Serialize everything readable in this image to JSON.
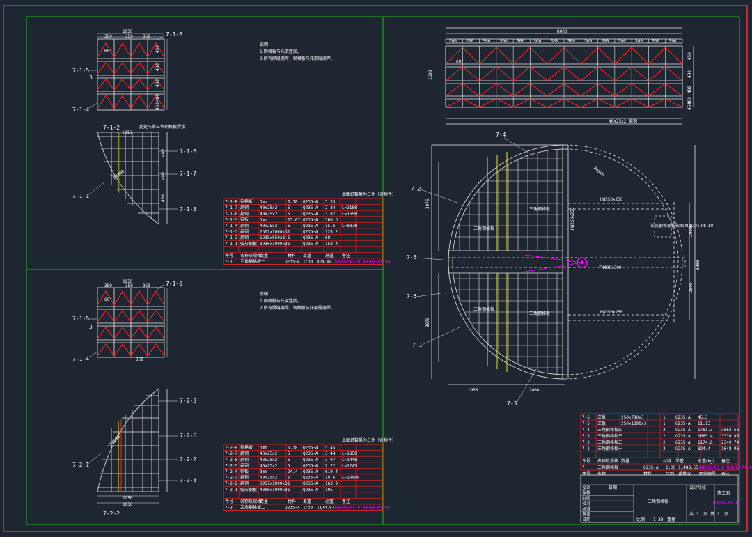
{
  "colors": {
    "background": "#1e2632",
    "border": "#ff2a2a",
    "frame": "#1fb81f",
    "line": "#e8e8e8",
    "red": "#ff2020",
    "yellow": "#e6e619",
    "magenta": "#ff00ff"
  },
  "view1": {
    "dims_top": [
      "1950",
      "350",
      "350",
      "350"
    ],
    "dims_right": [
      "450",
      "480",
      "480",
      "480",
      "450"
    ],
    "labels": {
      "tr": "7-1-6",
      "l1": "7-1-5",
      "l2": "3",
      "l3": "7-1-4",
      "ang": "60°"
    },
    "notes": [
      "说明",
      "1.网格板与托架连接。",
      "2.所有焊缝满焊，钢格板与托架需满焊。"
    ],
    "arc_labels": {
      "top": "7-1-2",
      "r1": "7-1-6",
      "r2": "7-1-7",
      "r3": "7-1-3",
      "l": "7-1-1",
      "top_note": "此处与第三块钢格板焊接"
    },
    "arc_dims": {
      "top": "1915",
      "diag": "R4000",
      "r1": "480",
      "r2": "480",
      "r3": "480"
    },
    "table_title": "本图纸数量为二件（对称件）",
    "rows": [
      [
        "7-1-8",
        "钢格板",
        "3mm",
        "0.18",
        "Q235-A",
        "3.53",
        ""
      ],
      [
        "7-1-7",
        "扁钢",
        "40x25x2",
        "5",
        "Q235-A",
        "2.34",
        "L=2180"
      ],
      [
        "7-1-6",
        "扁钢",
        "40x25x2",
        "5",
        "Q235-A",
        "3.07",
        "L=1658"
      ],
      [
        "7-1-5",
        "钢板",
        "3mm",
        "15.07",
        "Q235-A",
        "360.3",
        ""
      ],
      [
        "7-1-4",
        "扁钢",
        "40x25x2",
        "5",
        "Q235-A",
        "15.6",
        "L=8378"
      ],
      [
        "7-1-3",
        "扁钢",
        "2561x1000x3",
        "1",
        "Q235-A",
        "128.2",
        ""
      ],
      [
        "7-1-2",
        "扁钢",
        "1915x850x3",
        "1",
        "Q235-A",
        "68",
        ""
      ],
      [
        "7-1-1",
        "弧形钢板",
        "3930x1000x3",
        "1",
        "Q235-A",
        "158.4",
        ""
      ]
    ],
    "part": {
      "code": "7-1",
      "name": "三角钢格板一",
      "mat": "Q235-A",
      "scale": "1:30",
      "weight": "824.48",
      "ref": "NBD01-PS-8 NBD01-PS-04"
    },
    "header": [
      "件号",
      "名称及规格",
      "数量",
      "材料",
      "单重",
      "总重",
      "备注"
    ]
  },
  "view2": {
    "dims_top": [
      "1950",
      "350",
      "350",
      "350"
    ],
    "labels": {
      "tr": "7-1-0",
      "l1": "7-1-5",
      "l2": "3",
      "l3": "7-1-4",
      "ang": "60°",
      "bot": "350"
    },
    "notes": [
      "说明",
      "1.网格板与托架连接。",
      "2.所有焊缝满焊，钢格板与托架需满焊。"
    ],
    "arc_labels": {
      "r1": "7-2-3",
      "r2": "7-2-6",
      "r3": "7-2-7",
      "r4": "7-2-8",
      "l": "7-2-1",
      "bot": "7-2-2"
    },
    "arc_dims": {
      "diag": "R4000",
      "b1": "1950",
      "b2": "1950"
    },
    "table_title": "本图纸数量为二件（对称件）",
    "rows": [
      [
        "7-2-8",
        "钢格板",
        "3mm",
        "0.38",
        "Q235-A",
        "5.45",
        ""
      ],
      [
        "7-2-7",
        "扁钢",
        "40x25x2",
        "5",
        "Q235-A",
        "3.44",
        "L=1850"
      ],
      [
        "7-2-6",
        "扁钢",
        "40x25x2",
        "5",
        "Q235-A",
        "3.07",
        "L=1448"
      ],
      [
        "7-2-5",
        "扁钢",
        "40x25x2",
        "5",
        "Q235-A",
        "2.22",
        "L=1245"
      ],
      [
        "7-2-4",
        "钢板",
        "3mm",
        "24.4",
        "Q235-A",
        "610.4",
        ""
      ],
      [
        "7-2-3",
        "扁钢",
        "40x25x2",
        "5",
        "Q235-A",
        "18.6",
        "L=10000"
      ],
      [
        "7-2-2",
        "扁钢",
        "3951x1000x3",
        "1",
        "Q235-A",
        "163.9",
        ""
      ],
      [
        "7-2-1",
        "弧形钢板",
        "4300x1000x3",
        "1",
        "Q235-A",
        "195",
        ""
      ]
    ],
    "part": {
      "code": "7-2",
      "name": "三角钢格板二",
      "mat": "Q235-A",
      "scale": "1:30",
      "weight": "1174.87",
      "ref": "NBD01-PS-8 NBD01-PS-04"
    },
    "header": [
      "件号",
      "名称及规格",
      "数量",
      "材料",
      "单重",
      "总重",
      "备注"
    ]
  },
  "top_view": {
    "overall": "8000",
    "bays": [
      "500",
      "500",
      "500",
      "500",
      "500",
      "500",
      "500",
      "500",
      "500",
      "500",
      "500",
      "500",
      "500",
      "500"
    ],
    "height": "1500",
    "right_dims": [
      "450",
      "480",
      "480",
      "480",
      "450"
    ],
    "bottom_label": "40x25x2 扁钢",
    "ang": "60°"
  },
  "main_view": {
    "labels": {
      "a": "7-4",
      "b": "7-2",
      "c": "7-6",
      "d": "7-5",
      "e": "7-1",
      "f": "7-3"
    },
    "texts": {
      "t1": "三角钢格板",
      "t2": "三角钢格板",
      "t3": "三角钢格板",
      "t4": "三角钢格板",
      "beam1": "HW250x250",
      "beam2": "HW250x250",
      "beam3": "HW250x250",
      "center": "TW400x300",
      "support": "详见钢格板托架图\nNBD01-PS-10"
    },
    "dims": {
      "d1": "1950",
      "d2": "2000",
      "r": "8000",
      "h1": "3975",
      "h2": "3975",
      "hr1": "2000",
      "hr2": "2000",
      "arc": "R4000"
    }
  },
  "bom": {
    "rows": [
      [
        "7-6",
        "立板",
        "250x780x3",
        "1",
        "Q235-A",
        "45.3",
        ""
      ],
      [
        "7-5",
        "立板",
        "250x1890x3",
        "1",
        "Q235-A",
        "11.13",
        ""
      ],
      [
        "7-4",
        "三角钢格板四",
        "",
        "2",
        "Q235-A",
        "1781.3",
        "3562.56"
      ],
      [
        "7-3",
        "三角钢格板三",
        "",
        "2",
        "Q235-A",
        "1685.4",
        "3370.86"
      ],
      [
        "7-2",
        "三角钢格板二",
        "",
        "2",
        "Q235-A",
        "1174.8",
        "2349.74"
      ],
      [
        "7-1",
        "三角钢格板一",
        "",
        "2",
        "Q235-A",
        "824.4",
        "1648.96"
      ]
    ],
    "header": [
      "件号",
      "名称及规格",
      "数量",
      "材料",
      "单重",
      "总重(kg)",
      "备注"
    ],
    "part": {
      "code": "7",
      "name": "三角钢格板",
      "mat": "Q235-A",
      "scale": "1:30",
      "weight": "11488.55",
      "ref": "NBD01-PS-8 NBD01-PS-01"
    },
    "part_header": [
      "件号",
      "名称",
      "材料",
      "比例",
      "重量kg",
      "图纸编号",
      "备注"
    ]
  },
  "title_block": {
    "left": [
      "设计",
      "审核",
      "制图",
      "校对",
      "标准",
      "审定",
      "日期"
    ],
    "sign": "日期",
    "drawing_name": "三角钢格板",
    "project": "设计阶段",
    "stage": "施工图",
    "code": "NBD01-PS-01",
    "sheet": [
      "共",
      "1",
      "页",
      "第",
      "1",
      "页"
    ],
    "scale_label": "比例",
    "scale": "1:30",
    "weight_label": "重量"
  }
}
